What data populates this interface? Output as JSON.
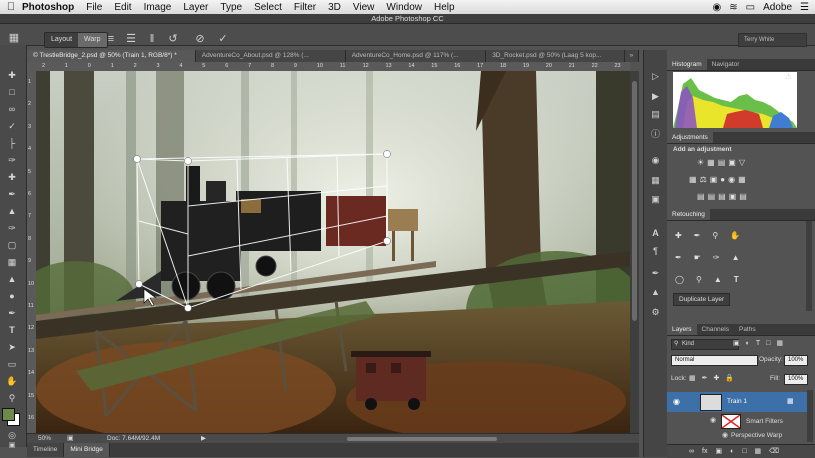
{
  "menubar": {
    "app_name": "Photoshop",
    "items": [
      "File",
      "Edit",
      "Image",
      "Layer",
      "Type",
      "Select",
      "Filter",
      "3D",
      "View",
      "Window",
      "Help"
    ],
    "window_title": "Adobe Photoshop CC",
    "right_label": "Adobe"
  },
  "options": {
    "layout_label": "Layout",
    "warp_label": "Warp",
    "workspace": "Terry White"
  },
  "tabs": [
    {
      "label": "© TrestleBridge_2.psd @ 50% (Train 1, RGB/8*) *",
      "active": true
    },
    {
      "label": "AdventureCo_About.psd @ 128% (...",
      "active": false
    },
    {
      "label": "AdventureCo_Home.psd @ 117% (...",
      "active": false
    },
    {
      "label": "3D_Rocket.psd @ 50% (Laag 5 kop...",
      "active": false
    }
  ],
  "ruler_top": [
    "2",
    "1",
    "0",
    "1",
    "2",
    "3",
    "4",
    "5",
    "6",
    "7",
    "8",
    "9",
    "10",
    "11",
    "12",
    "13",
    "14",
    "15",
    "16",
    "17",
    "18",
    "19",
    "20",
    "21",
    "22",
    "23"
  ],
  "ruler_left": [
    "1",
    "2",
    "3",
    "4",
    "5",
    "6",
    "7",
    "8",
    "9",
    "10",
    "11",
    "12",
    "13",
    "14",
    "15",
    "16"
  ],
  "status": {
    "zoom": "50%",
    "doc": "Doc: 7.64M/92.4M"
  },
  "bottom_tabs": [
    {
      "label": "Timeline",
      "active": false
    },
    {
      "label": "Mini Bridge",
      "active": true
    }
  ],
  "histogram_panel": {
    "tabs": [
      {
        "label": "Histogram",
        "active": true
      },
      {
        "label": "Navigator",
        "active": false
      }
    ]
  },
  "adjustments_panel": {
    "tab": "Adjustments",
    "heading": "Add an adjustment"
  },
  "retouching_panel": {
    "tab": "Retouching",
    "duplicate_button": "Duplicate Layer"
  },
  "layers_panel": {
    "tabs": [
      {
        "label": "Layers",
        "active": true
      },
      {
        "label": "Channels",
        "active": false
      },
      {
        "label": "Paths",
        "active": false
      }
    ],
    "filter_kind": "Kind",
    "blend_mode": "Normal",
    "opacity_label": "Opacity:",
    "opacity_value": "100%",
    "lock_label": "Lock:",
    "fill_label": "Fill:",
    "fill_value": "100%",
    "layers": [
      {
        "name": "Train 1",
        "type": "smart-object"
      },
      {
        "name": "Smart Filters",
        "type": "smart-filters"
      },
      {
        "name": "Perspective Warp",
        "type": "filter"
      }
    ]
  },
  "colors": {
    "accent": "#3d6fa8",
    "foreground": "#6d8a4c",
    "background": "#ffffff"
  }
}
